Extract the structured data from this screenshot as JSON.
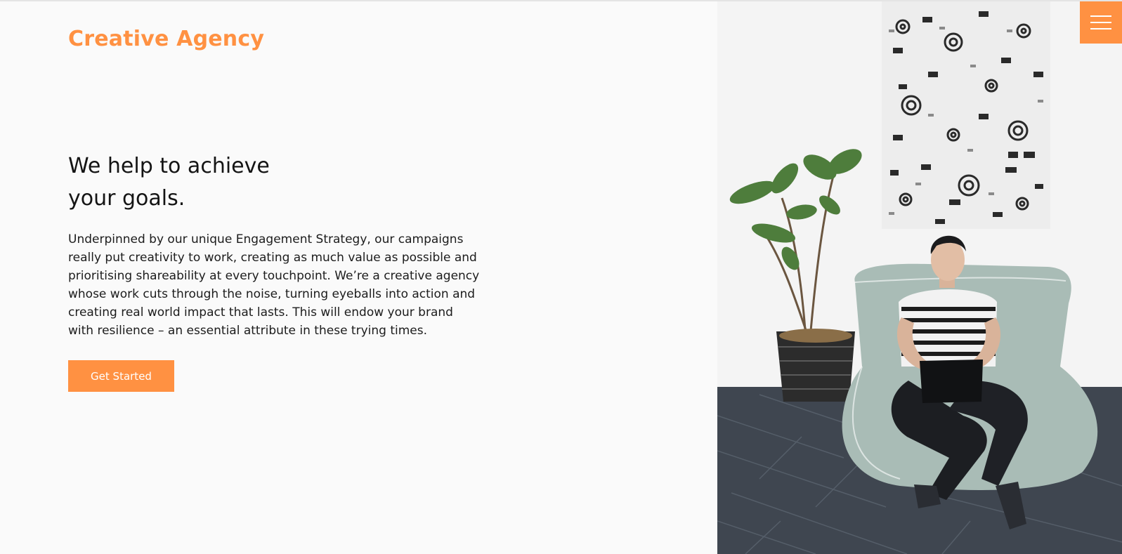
{
  "brand": {
    "name": "Creative Agency",
    "color": "#ff9142"
  },
  "hero": {
    "headline_lines": [
      "We help to achieve",
      "your goals."
    ],
    "body_lines": [
      "Underpinned by our unique Engagement Strategy, our campaigns",
      "really put creativity to work, creating as much value as possible and",
      "prioritising shareability at every touchpoint. We’re a creative agency",
      "whose work cuts through the noise, turning eyeballs into action and",
      "creating real world impact that lasts. This will endow your brand",
      "with resilience – an essential attribute in these trying times."
    ],
    "cta_label": "Get Started",
    "cta_color": "#ff9142"
  },
  "menu": {
    "icon": "hamburger-icon",
    "color": "#ff9142"
  },
  "photo": {
    "description_icon": "person-on-beanbag-photo"
  }
}
